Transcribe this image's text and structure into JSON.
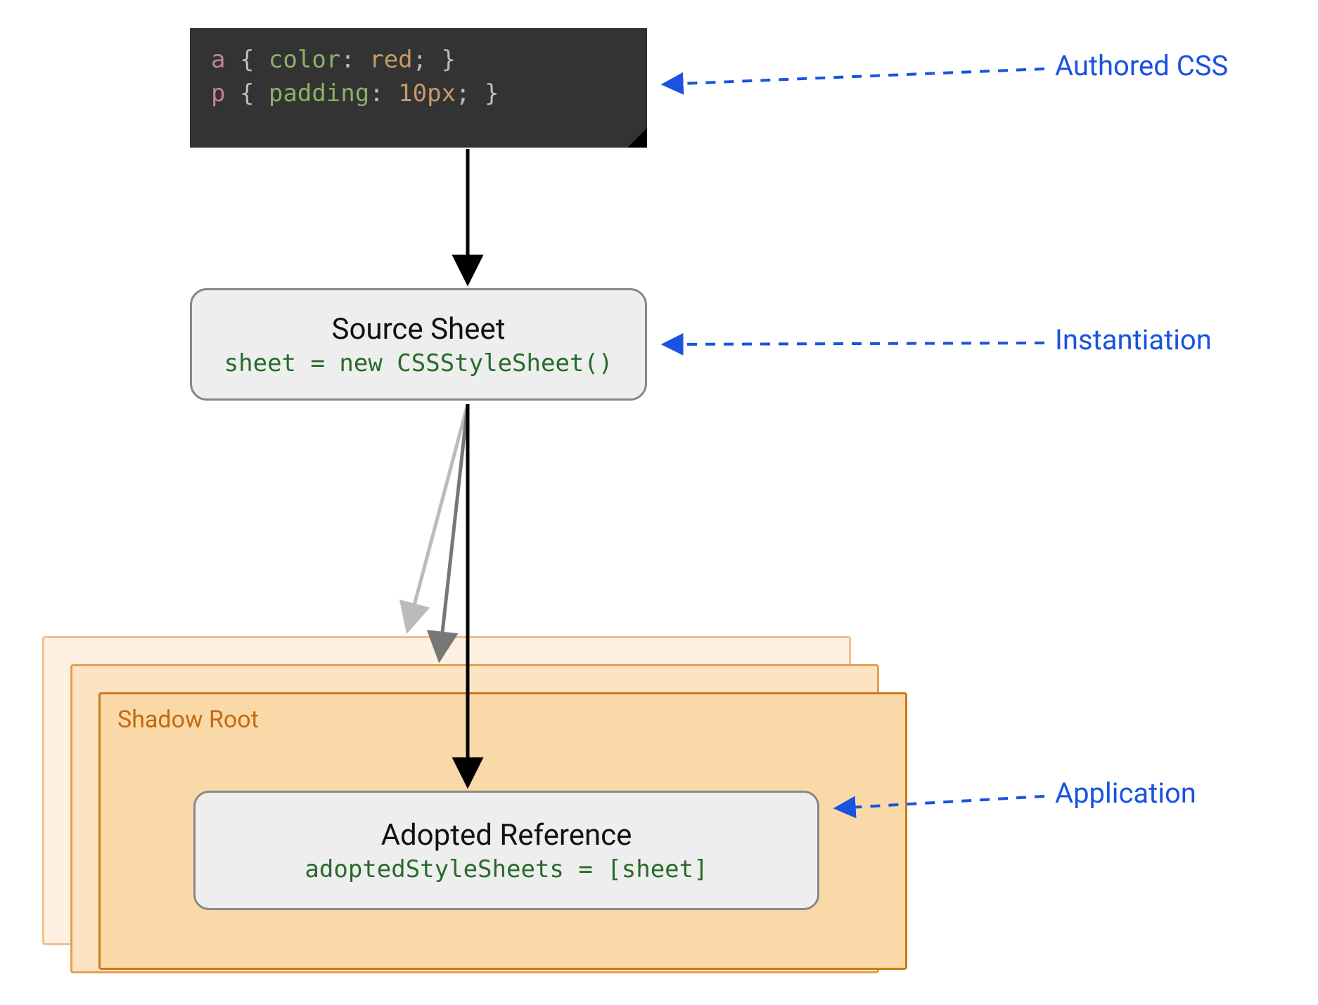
{
  "code_block": {
    "line1": {
      "selector": "a",
      "open": " { ",
      "prop": "color",
      "colon": ": ",
      "value": "red",
      "close": "; }"
    },
    "line2": {
      "selector": "p",
      "open": " { ",
      "prop": "padding",
      "colon": ": ",
      "value": "10px",
      "close": "; }"
    }
  },
  "source_sheet": {
    "title": "Source Sheet",
    "code": "sheet = new CSSStyleSheet()"
  },
  "shadow_root": {
    "label": "Shadow Root"
  },
  "adopted_reference": {
    "title": "Adopted Reference",
    "code": "adoptedStyleSheets = [sheet]"
  },
  "annotations": {
    "authored_css": "Authored CSS",
    "instantiation": "Instantiation",
    "application": "Application"
  }
}
